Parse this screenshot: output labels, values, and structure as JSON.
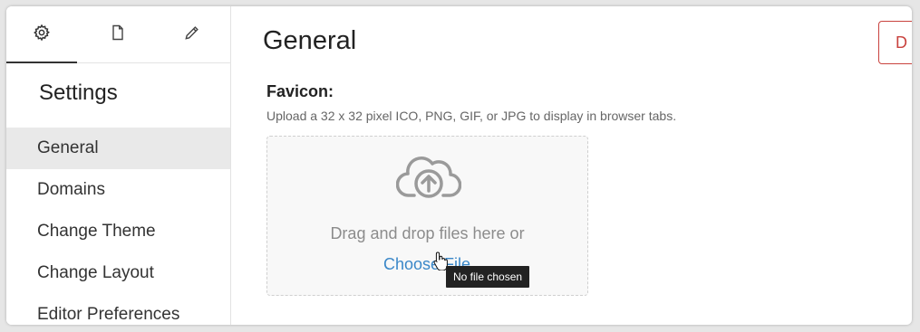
{
  "sidebar": {
    "tabs": [
      {
        "icon": "gear-icon"
      },
      {
        "icon": "document-icon"
      },
      {
        "icon": "pencil-icon"
      }
    ],
    "title": "Settings",
    "items": [
      {
        "label": "General",
        "active": true
      },
      {
        "label": "Domains"
      },
      {
        "label": "Change Theme"
      },
      {
        "label": "Change Layout"
      },
      {
        "label": "Editor Preferences"
      }
    ]
  },
  "main": {
    "title": "General",
    "corner_button_label": "D",
    "favicon": {
      "label": "Favicon:",
      "help": "Upload a 32 x 32 pixel ICO, PNG, GIF, or JPG to display in browser tabs.",
      "dropzone_text": "Drag and drop files here or",
      "choose_link": "Choose File",
      "tooltip": "No file chosen"
    }
  },
  "colors": {
    "accent": "#3a87c8",
    "danger": "#c9423e",
    "active_nav_bg": "#e9e9e9"
  }
}
